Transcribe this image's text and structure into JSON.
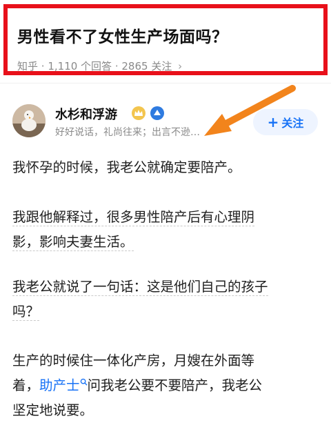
{
  "question": {
    "title": "男性看不了女性生产场面吗？",
    "source": "知乎",
    "answers": "1,110 个回答",
    "followers": "2865 关注",
    "chevron": "›"
  },
  "author": {
    "name": "水杉和浮游",
    "bio": "好好说话，礼尚往来；出言不逊…",
    "follow_label": "关注",
    "follow_plus": "+"
  },
  "content": {
    "p1": "我怀孕的时候，我老公就确定要陪产。",
    "p2_line1": "我跟他解释过，很多男性陪产后有心理阴",
    "p2_line2": "影，影响夫妻生活。",
    "p3_line1": "我老公就说了一句话：这是他们自己的孩子",
    "p3_line2": "吗？",
    "p4_line1": "生产的时候住一体化产房，月嫂在外面等",
    "p4_line2_pre": "着，",
    "p4_link": "助产士",
    "p4_line2_post": "问我老公要不要陪产，我老公",
    "p4_line3": "坚定地说要。"
  },
  "colors": {
    "highlight_border": "#e8101a",
    "arrow": "#f2841c",
    "link": "#1772f6",
    "follow_bg": "#eef4ff"
  },
  "icons": {
    "crown_badge": "crown-icon",
    "level_badge": "level-icon",
    "search_link": "search-icon",
    "annotation_arrow": "arrow-icon"
  }
}
